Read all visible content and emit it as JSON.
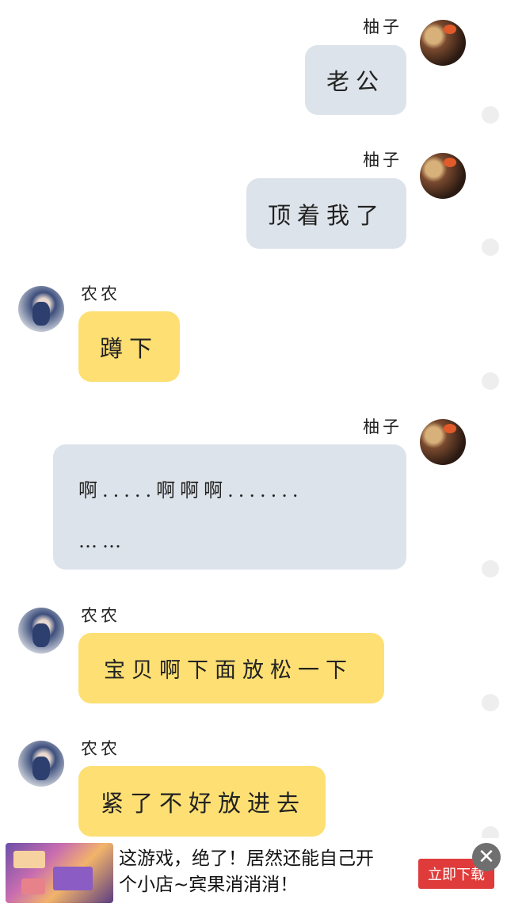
{
  "users": {
    "right_name": "柚子",
    "left_name": "农农"
  },
  "messages": [
    {
      "side": "right",
      "name": "柚子",
      "text": "老公"
    },
    {
      "side": "right",
      "name": "柚子",
      "text": "顶着我了"
    },
    {
      "side": "left",
      "name": "农农",
      "text": "蹲下"
    },
    {
      "side": "right",
      "name": "柚子",
      "line1": "啊.....啊啊啊.......",
      "line2": "……"
    },
    {
      "side": "left",
      "name": "农农",
      "text": "宝贝啊下面放松一下"
    },
    {
      "side": "left",
      "name": "农农",
      "text": "紧了不好放进去"
    }
  ],
  "ad": {
    "line1": "这游戏，绝了！居然还能自己开",
    "line2": "个小店~宾果消消消！",
    "button": "立即下载",
    "close": "✕"
  },
  "colors": {
    "right_bubble": "#dde3ea",
    "left_bubble": "#fddf73",
    "ad_button": "#e03b3b"
  }
}
